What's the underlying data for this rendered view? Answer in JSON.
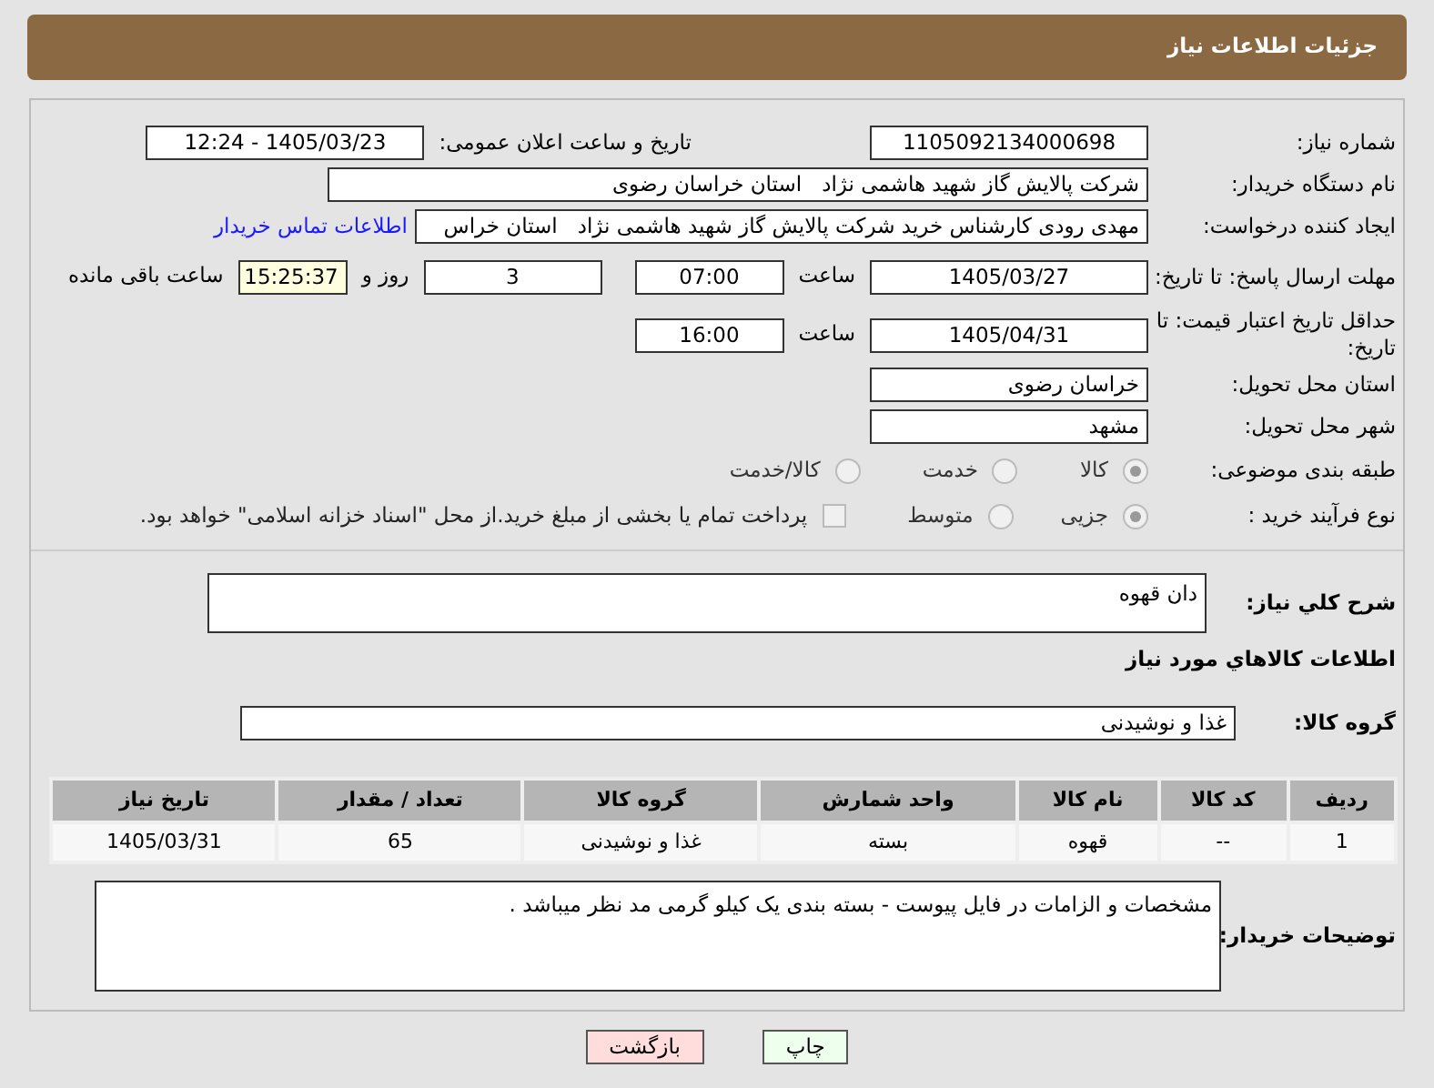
{
  "header": {
    "title": "جزئیات اطلاعات نیاز"
  },
  "need_number": {
    "label": "شماره نیاز:",
    "value": "1105092134000698"
  },
  "announce": {
    "label": "تاریخ و ساعت اعلان عمومی:",
    "value": "1405/03/23 - 12:24"
  },
  "buyer_org": {
    "label": "نام دستگاه خریدار:",
    "value": "شرکت پالایش گاز شهید هاشمی نژاد   استان خراسان رضوی"
  },
  "requester": {
    "label": "ایجاد کننده درخواست:",
    "value": "مهدی رودی کارشناس خرید شرکت پالایش گاز شهید هاشمی نژاد   استان خراس",
    "link": "اطلاعات تماس خریدار"
  },
  "response_deadline": {
    "label": "مهلت ارسال پاسخ: تا تاریخ:",
    "date": "1405/03/27",
    "time_label": "ساعت",
    "time": "07:00",
    "days": "3",
    "days_label": "روز و",
    "remaining": "15:25:37",
    "remaining_label": "ساعت باقی مانده"
  },
  "price_validity": {
    "label": "حداقل تاریخ اعتبار قیمت: تا تاریخ:",
    "date": "1405/04/31",
    "time_label": "ساعت",
    "time": "16:00"
  },
  "province": {
    "label": "استان محل تحویل:",
    "value": "خراسان رضوی"
  },
  "city": {
    "label": "شهر محل تحویل:",
    "value": "مشهد"
  },
  "category": {
    "label": "طبقه بندی موضوعی:",
    "options": [
      {
        "label": "کالا",
        "selected": true
      },
      {
        "label": "خدمت",
        "selected": false
      },
      {
        "label": "کالا/خدمت",
        "selected": false
      }
    ]
  },
  "process": {
    "label": "نوع فرآیند خرید :",
    "options": [
      {
        "label": "جزیی",
        "selected": true
      },
      {
        "label": "متوسط",
        "selected": false
      }
    ],
    "treasury": {
      "checked": false,
      "text": "پرداخت تمام یا بخشی از مبلغ خرید.از محل \"اسناد خزانه اسلامی\" خواهد بود."
    }
  },
  "description": {
    "label": "شرح کلي نیاز:",
    "value": "دان قهوه"
  },
  "goods_heading": "اطلاعات کالاهاي مورد نياز",
  "goods_group": {
    "label": "گروه کالا:",
    "value": "غذا و نوشیدنی"
  },
  "table": {
    "columns": [
      "ردیف",
      "کد کالا",
      "نام کالا",
      "واحد شمارش",
      "گروه کالا",
      "تعداد / مقدار",
      "تاریخ نیاز"
    ],
    "rows": [
      [
        "1",
        "--",
        "قهوه",
        "بسته",
        "غذا و نوشیدنی",
        "65",
        "1405/03/31"
      ]
    ]
  },
  "buyer_notes": {
    "label": "توضیحات خریدار:",
    "value": "مشخصات و الزامات در فایل پیوست -  بسته بندی یک کیلو گرمی  مد نظر میباشد ."
  },
  "buttons": [
    {
      "label": "چاپ",
      "kind": "print"
    },
    {
      "label": "بازگشت",
      "kind": "back"
    }
  ]
}
